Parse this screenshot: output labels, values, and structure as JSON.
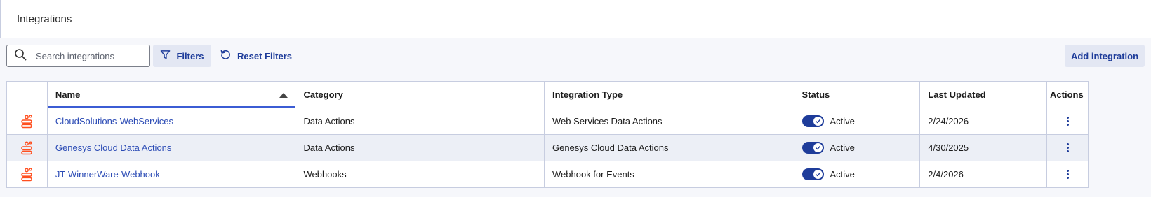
{
  "header": {
    "title": "Integrations"
  },
  "toolbar": {
    "search_placeholder": "Search integrations",
    "filters_label": "Filters",
    "reset_label": "Reset Filters",
    "add_label": "Add integration"
  },
  "table": {
    "columns": [
      "",
      "Name",
      "Category",
      "Integration Type",
      "Status",
      "Last Updated",
      "Actions"
    ],
    "sorted_column": "Name",
    "sort_direction": "ascending",
    "rows": [
      {
        "name": "CloudSolutions-WebServices",
        "category": "Data Actions",
        "type": "Web Services Data Actions",
        "status": "Active",
        "status_on": true,
        "updated": "2/24/2026"
      },
      {
        "name": "Genesys Cloud Data Actions",
        "category": "Data Actions",
        "type": "Genesys Cloud Data Actions",
        "status": "Active",
        "status_on": true,
        "updated": "4/30/2025"
      },
      {
        "name": "JT-WinnerWare-Webhook",
        "category": "Webhooks",
        "type": "Webhook for Events",
        "status": "Active",
        "status_on": true,
        "updated": "2/4/2026"
      }
    ]
  },
  "colors": {
    "accent": "#1e3c9a",
    "link": "#2b4bb5",
    "icon_orange": "#ff4f1f",
    "row_alt": "#eceff6"
  },
  "icons": {
    "search": "search-icon",
    "filter": "filter-icon",
    "reset": "reset-icon",
    "integration": "integration-icon",
    "more": "more-vertical-icon"
  }
}
